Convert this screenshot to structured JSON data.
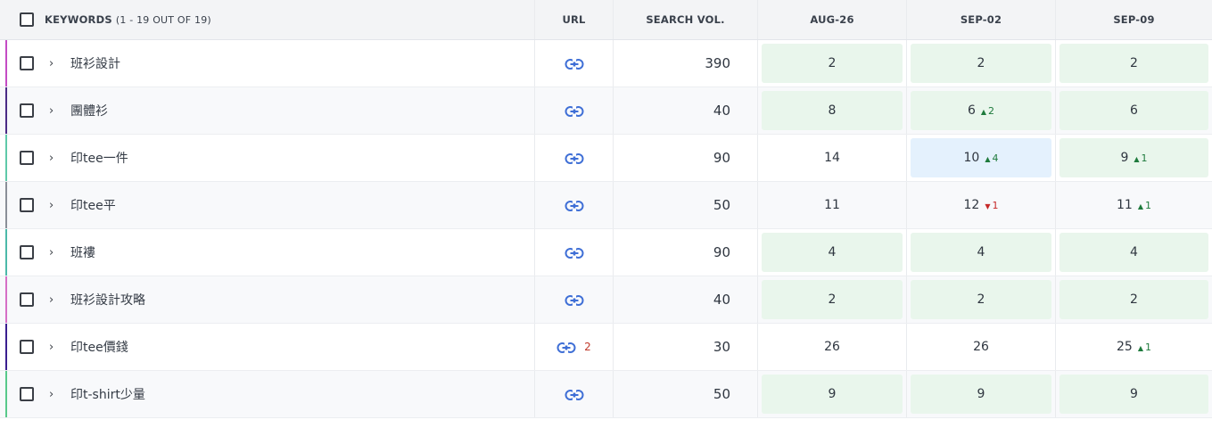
{
  "header": {
    "keywords_label": "KEYWORDS",
    "keywords_count": "(1 - 19 OUT OF 19)",
    "url_label": "URL",
    "search_vol_label": "SEARCH VOL.",
    "dates": [
      "AUG-26",
      "SEP-02",
      "SEP-09"
    ]
  },
  "colors": {
    "positive_bg": "#e9f6ec",
    "highlight_bg": "#e4f1fd",
    "up": "#1e7a3c",
    "down": "#c62828"
  },
  "rows": [
    {
      "keyword": "班衫設計",
      "bar_color": "#c44bc4",
      "url_count": "",
      "volume": "390",
      "ranks": [
        {
          "value": "2",
          "delta": "",
          "dir": "",
          "bg": "green"
        },
        {
          "value": "2",
          "delta": "",
          "dir": "",
          "bg": "green"
        },
        {
          "value": "2",
          "delta": "",
          "dir": "",
          "bg": "green"
        }
      ]
    },
    {
      "keyword": "團體衫",
      "bar_color": "#4b2b86",
      "url_count": "",
      "volume": "40",
      "ranks": [
        {
          "value": "8",
          "delta": "",
          "dir": "",
          "bg": "green"
        },
        {
          "value": "6",
          "delta": "2",
          "dir": "up",
          "bg": "green"
        },
        {
          "value": "6",
          "delta": "",
          "dir": "",
          "bg": "green"
        }
      ]
    },
    {
      "keyword": "印tee一件",
      "bar_color": "#5fc9a9",
      "url_count": "",
      "volume": "90",
      "ranks": [
        {
          "value": "14",
          "delta": "",
          "dir": "",
          "bg": ""
        },
        {
          "value": "10",
          "delta": "4",
          "dir": "up",
          "bg": "blue"
        },
        {
          "value": "9",
          "delta": "1",
          "dir": "up",
          "bg": "green"
        }
      ]
    },
    {
      "keyword": "印tee平",
      "bar_color": "#8a8f98",
      "url_count": "",
      "volume": "50",
      "ranks": [
        {
          "value": "11",
          "delta": "",
          "dir": "",
          "bg": ""
        },
        {
          "value": "12",
          "delta": "1",
          "dir": "down",
          "bg": ""
        },
        {
          "value": "11",
          "delta": "1",
          "dir": "up",
          "bg": ""
        }
      ]
    },
    {
      "keyword": "班褸",
      "bar_color": "#4bb9a9",
      "url_count": "",
      "volume": "90",
      "ranks": [
        {
          "value": "4",
          "delta": "",
          "dir": "",
          "bg": "green"
        },
        {
          "value": "4",
          "delta": "",
          "dir": "",
          "bg": "green"
        },
        {
          "value": "4",
          "delta": "",
          "dir": "",
          "bg": "green"
        }
      ]
    },
    {
      "keyword": "班衫設計攻略",
      "bar_color": "#d66fc6",
      "url_count": "",
      "volume": "40",
      "ranks": [
        {
          "value": "2",
          "delta": "",
          "dir": "",
          "bg": "green"
        },
        {
          "value": "2",
          "delta": "",
          "dir": "",
          "bg": "green"
        },
        {
          "value": "2",
          "delta": "",
          "dir": "",
          "bg": "green"
        }
      ]
    },
    {
      "keyword": "印tee價錢",
      "bar_color": "#3a1f8f",
      "url_count": "2",
      "volume": "30",
      "ranks": [
        {
          "value": "26",
          "delta": "",
          "dir": "",
          "bg": ""
        },
        {
          "value": "26",
          "delta": "",
          "dir": "",
          "bg": ""
        },
        {
          "value": "25",
          "delta": "1",
          "dir": "up",
          "bg": ""
        }
      ]
    },
    {
      "keyword": "印t-shirt少量",
      "bar_color": "#58c98a",
      "url_count": "",
      "volume": "50",
      "ranks": [
        {
          "value": "9",
          "delta": "",
          "dir": "",
          "bg": "green"
        },
        {
          "value": "9",
          "delta": "",
          "dir": "",
          "bg": "green"
        },
        {
          "value": "9",
          "delta": "",
          "dir": "",
          "bg": "green"
        }
      ]
    }
  ]
}
